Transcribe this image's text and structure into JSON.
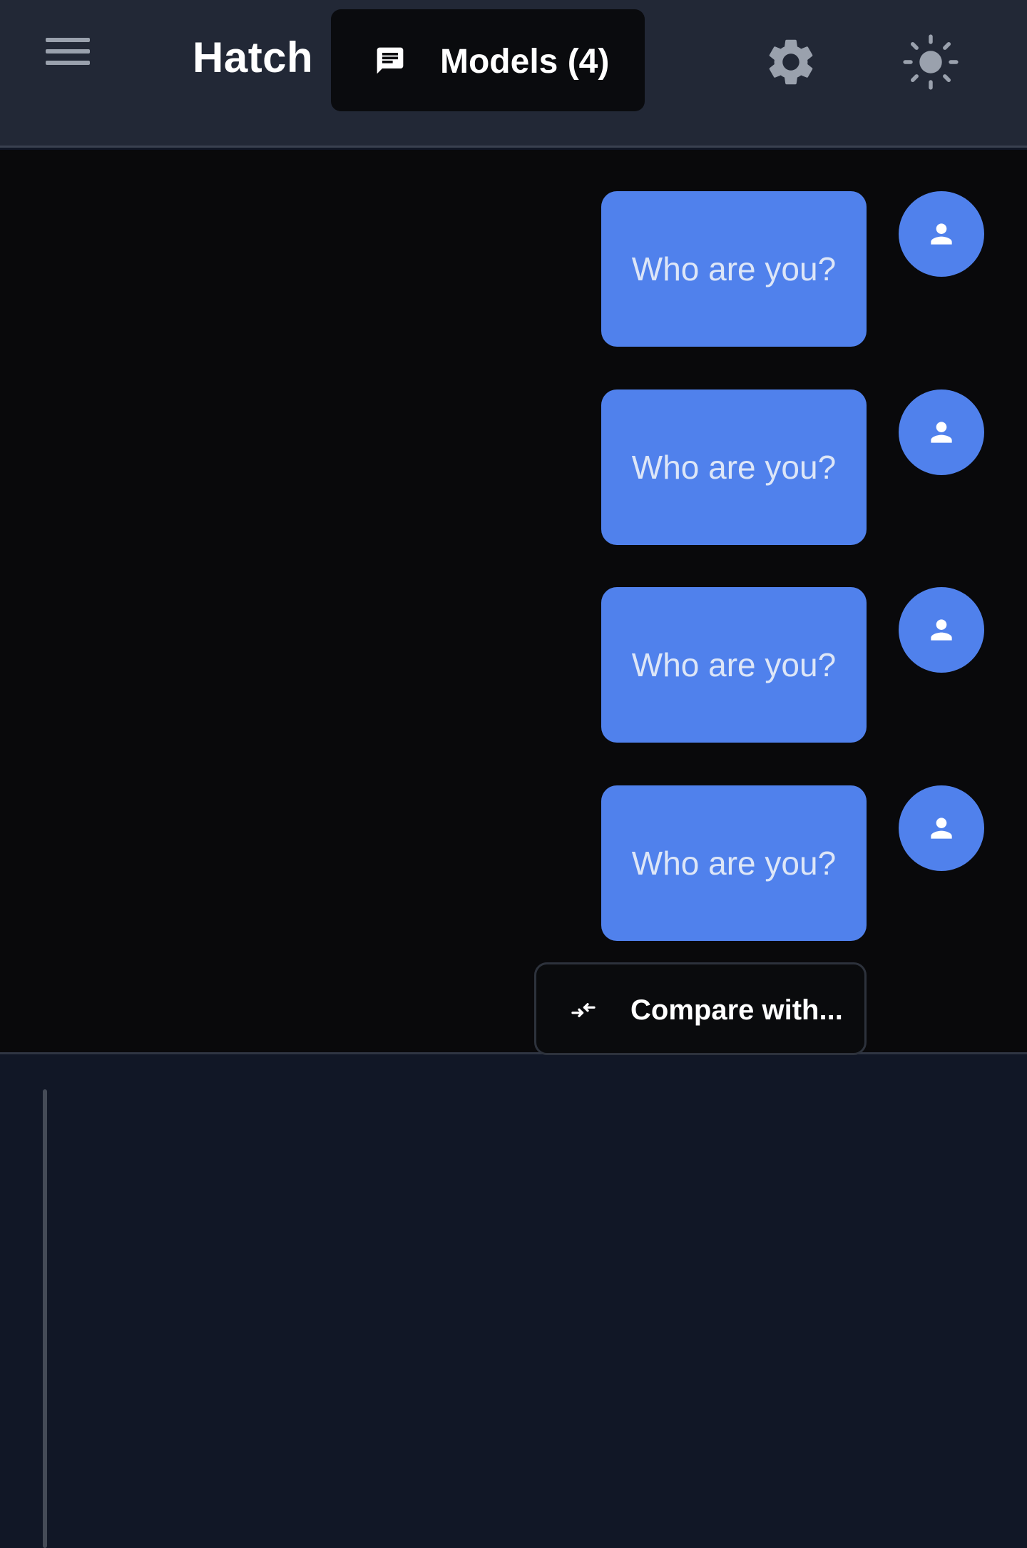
{
  "header": {
    "menu_icon": "hamburger-menu-icon",
    "brand": "Hatch",
    "models_button": {
      "icon": "chat-icon",
      "label": "Models (4)"
    },
    "settings_icon": "gear-icon",
    "theme_icon": "sun-icon"
  },
  "chat": {
    "messages": [
      {
        "text": "Who are you?",
        "avatar_icon": "user-icon"
      },
      {
        "text": "Who are you?",
        "avatar_icon": "user-icon"
      },
      {
        "text": "Who are you?",
        "avatar_icon": "user-icon"
      },
      {
        "text": "Who are you?",
        "avatar_icon": "user-icon"
      }
    ],
    "compare_button": {
      "icon": "compare-arrows-icon",
      "label": "Compare with..."
    }
  },
  "colors": {
    "header_bg": "#222836",
    "chat_bg": "#09090b",
    "panel_bg": "#111726",
    "accent": "#5081ec",
    "icon_gray": "#9aa1ad",
    "text_light": "#dde6f7"
  }
}
